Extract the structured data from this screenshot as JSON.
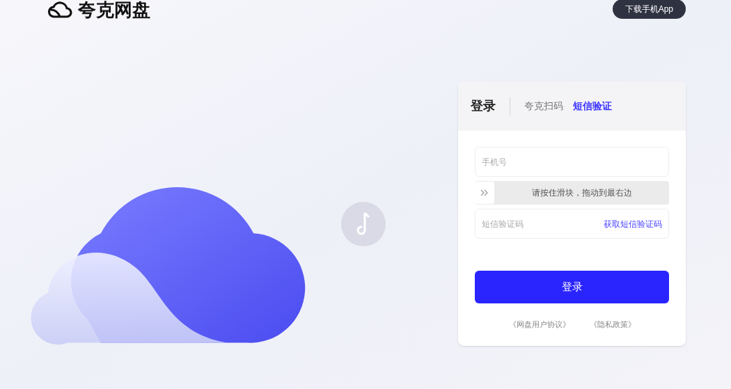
{
  "header": {
    "logo_text": "夸克网盘",
    "download_button": "下载手机App"
  },
  "login": {
    "title": "登录",
    "tabs": [
      {
        "label": "夸克扫码",
        "selected": false
      },
      {
        "label": "短信验证",
        "selected": true
      }
    ],
    "phone_field": {
      "placeholder": "手机号"
    },
    "slider": {
      "label": "请按住滑块，拖动到最右边",
      "level": 0
    },
    "code_field": {
      "placeholder": "短信验证码",
      "action": "获取短信验证码"
    },
    "submit": "登录",
    "links": [
      "《网盘用户协议》",
      "《隐私政策》"
    ]
  }
}
